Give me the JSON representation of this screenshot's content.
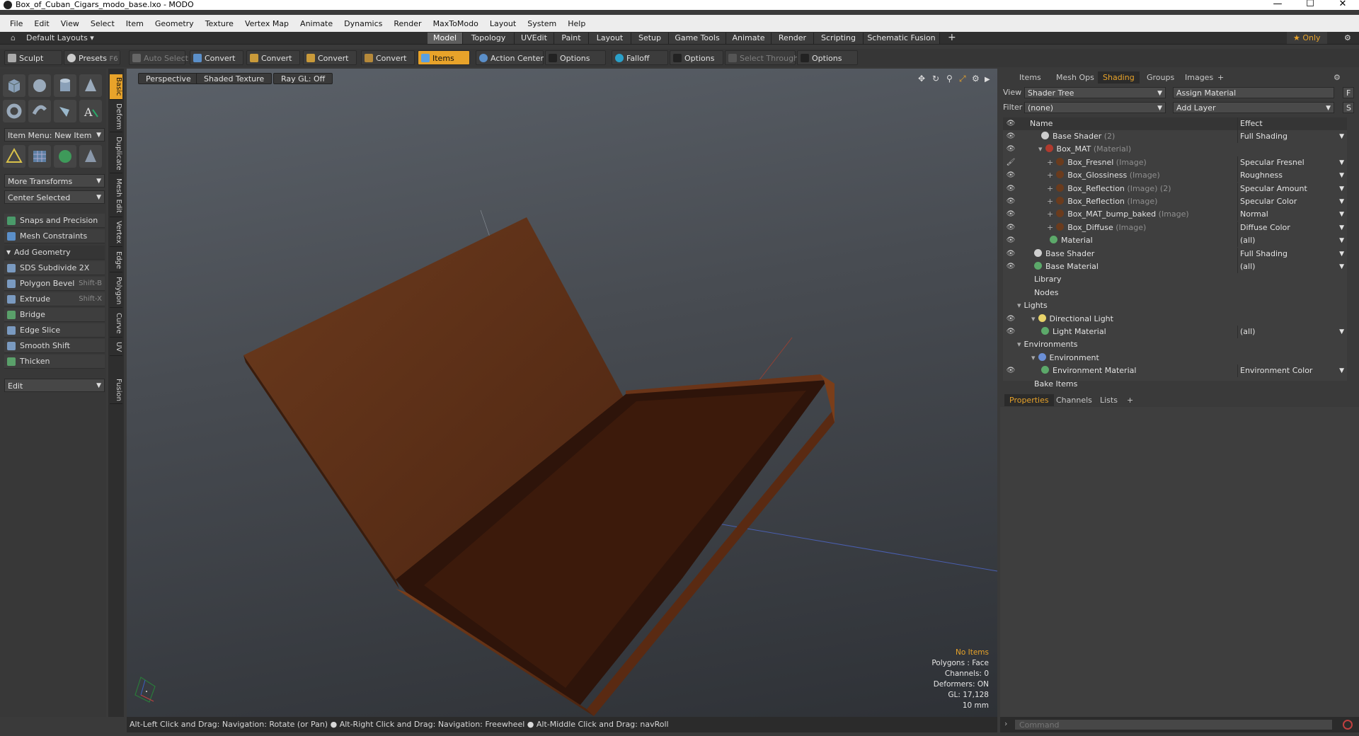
{
  "window": {
    "title": "Box_of_Cuban_Cigars_modo_base.lxo - MODO",
    "min": "—",
    "max": "☐",
    "close": "✕"
  },
  "menu": [
    "File",
    "Edit",
    "View",
    "Select",
    "Item",
    "Geometry",
    "Texture",
    "Vertex Map",
    "Animate",
    "Dynamics",
    "Render",
    "MaxToModo",
    "Layout",
    "System",
    "Help"
  ],
  "layoutbar": {
    "preset": "Default Layouts ▾",
    "tabs": [
      "Model",
      "Topology",
      "UVEdit",
      "Paint",
      "Layout",
      "Setup",
      "Game Tools",
      "Animate",
      "Render",
      "Scripting",
      "Schematic Fusion"
    ],
    "active_tab": "Model",
    "add": "+",
    "only": "★ Only",
    "gear": "⚙"
  },
  "toolbar": {
    "sculpt": "Sculpt",
    "presets": "Presets",
    "presets_key": "F6",
    "auto_select": "Auto Select",
    "convert1": "Convert",
    "convert2": "Convert",
    "convert3": "Convert",
    "convert4": "Convert",
    "items": "Items",
    "action_center": "Action Center",
    "options1": "Options",
    "falloff": "Falloff",
    "options2": "Options",
    "select_through": "Select Through",
    "options3": "Options"
  },
  "left": {
    "item_menu": "Item Menu: New Item",
    "more_transforms": "More Transforms",
    "center_selected": "Center Selected",
    "snaps": "Snaps and Precision",
    "mesh_constraints": "Mesh Constraints",
    "add_geometry": "Add Geometry",
    "tools": [
      {
        "label": "SDS Subdivide 2X",
        "key": ""
      },
      {
        "label": "Polygon Bevel",
        "key": "Shift-B"
      },
      {
        "label": "Extrude",
        "key": "Shift-X"
      },
      {
        "label": "Bridge",
        "key": ""
      },
      {
        "label": "Edge Slice",
        "key": ""
      },
      {
        "label": "Smooth Shift",
        "key": ""
      },
      {
        "label": "Thicken",
        "key": ""
      }
    ],
    "edit": "Edit",
    "vtabs": [
      "Basic",
      "Deform",
      "Duplicate",
      "Mesh Edit",
      "Vertex",
      "Edge",
      "Polygon",
      "Curve",
      "UV",
      "Fusion"
    ]
  },
  "viewport": {
    "perspective": "Perspective",
    "shading": "Shaded Texture",
    "raygl": "Ray GL: Off",
    "info": {
      "no_items": "No Items",
      "polygons": "Polygons : Face",
      "channels": "Channels: 0",
      "deformers": "Deformers: ON",
      "gl": "GL: 17,128",
      "unit": "10 mm"
    }
  },
  "status": "Alt-Left Click and Drag: Navigation: Rotate (or Pan) ● Alt-Right Click and Drag: Navigation: Freewheel ● Alt-Middle Click and Drag: navRoll",
  "right": {
    "tabs": [
      "Items",
      "Mesh Ops",
      "Shading",
      "Groups",
      "Images",
      "+"
    ],
    "active_tab": "Shading",
    "view_label": "View",
    "view_value": "Shader Tree",
    "assign_material": "Assign Material",
    "f_btn": "F",
    "filter_label": "Filter",
    "filter_value": "(none)",
    "add_layer": "Add Layer",
    "s_btn": "S",
    "col_name": "Name",
    "col_effect": "Effect",
    "tree": [
      {
        "eye": "👁",
        "expand": "",
        "name": "Base Shader",
        "sub": "(2)",
        "effect": "Full Shading",
        "icon": "#cfcfcf"
      },
      {
        "eye": "👁",
        "expand": "▾",
        "name": "Box_MAT",
        "sub": "(Material)",
        "effect": "",
        "icon": "#b03a2e"
      },
      {
        "eye": "🖌",
        "expand": "+",
        "name": "Box_Fresnel",
        "sub": "(Image)",
        "effect": "Specular Fresnel",
        "icon": "#6a3b1d"
      },
      {
        "eye": "👁",
        "expand": "+",
        "name": "Box_Glossiness",
        "sub": "(Image)",
        "effect": "Roughness",
        "icon": "#6a3b1d"
      },
      {
        "eye": "👁",
        "expand": "+",
        "name": "Box_Reflection",
        "sub": "(Image) (2)",
        "effect": "Specular Amount",
        "icon": "#6a3b1d"
      },
      {
        "eye": "👁",
        "expand": "+",
        "name": "Box_Reflection",
        "sub": "(Image)",
        "effect": "Specular Color",
        "icon": "#6a3b1d"
      },
      {
        "eye": "👁",
        "expand": "+",
        "name": "Box_MAT_bump_baked",
        "sub": "(Image)",
        "effect": "Normal",
        "icon": "#6a3b1d"
      },
      {
        "eye": "👁",
        "expand": "+",
        "name": "Box_Diffuse",
        "sub": "(Image)",
        "effect": "Diffuse Color",
        "icon": "#6a3b1d"
      },
      {
        "eye": "👁",
        "expand": "",
        "name": "Material",
        "sub": "",
        "effect": "(all)",
        "icon": "#5ca96a"
      },
      {
        "eye": "👁",
        "expand": "",
        "name": "Base Shader",
        "sub": "",
        "effect": "Full Shading",
        "icon": "#cfcfcf"
      },
      {
        "eye": "👁",
        "expand": "",
        "name": "Base Material",
        "sub": "",
        "effect": "(all)",
        "icon": "#5ca96a"
      },
      {
        "eye": "",
        "expand": "",
        "name": "Library",
        "sub": "",
        "effect": "",
        "icon": ""
      },
      {
        "eye": "",
        "expand": "",
        "name": "Nodes",
        "sub": "",
        "effect": "",
        "icon": ""
      },
      {
        "eye": "",
        "expand": "▾",
        "name": "Lights",
        "sub": "",
        "effect": "",
        "icon": ""
      },
      {
        "eye": "👁",
        "expand": "▾",
        "name": "Directional Light",
        "sub": "",
        "effect": "",
        "icon": "#e8d36a"
      },
      {
        "eye": "👁",
        "expand": "",
        "name": "Light Material",
        "sub": "",
        "effect": "(all)",
        "icon": "#5ca96a"
      },
      {
        "eye": "",
        "expand": "▾",
        "name": "Environments",
        "sub": "",
        "effect": "",
        "icon": ""
      },
      {
        "eye": "",
        "expand": "▾",
        "name": "Environment",
        "sub": "",
        "effect": "",
        "icon": "#6b8fd6"
      },
      {
        "eye": "👁",
        "expand": "",
        "name": "Environment Material",
        "sub": "",
        "effect": "Environment Color",
        "icon": "#5ca96a"
      },
      {
        "eye": "",
        "expand": "",
        "name": "Bake Items",
        "sub": "",
        "effect": "",
        "icon": ""
      }
    ],
    "bottom_tabs": [
      "Properties",
      "Channels",
      "Lists",
      "+"
    ],
    "bottom_active": "Properties",
    "command_placeholder": "Command"
  },
  "colors": {
    "accent": "#e8a32a",
    "wood": "#6a3418"
  }
}
